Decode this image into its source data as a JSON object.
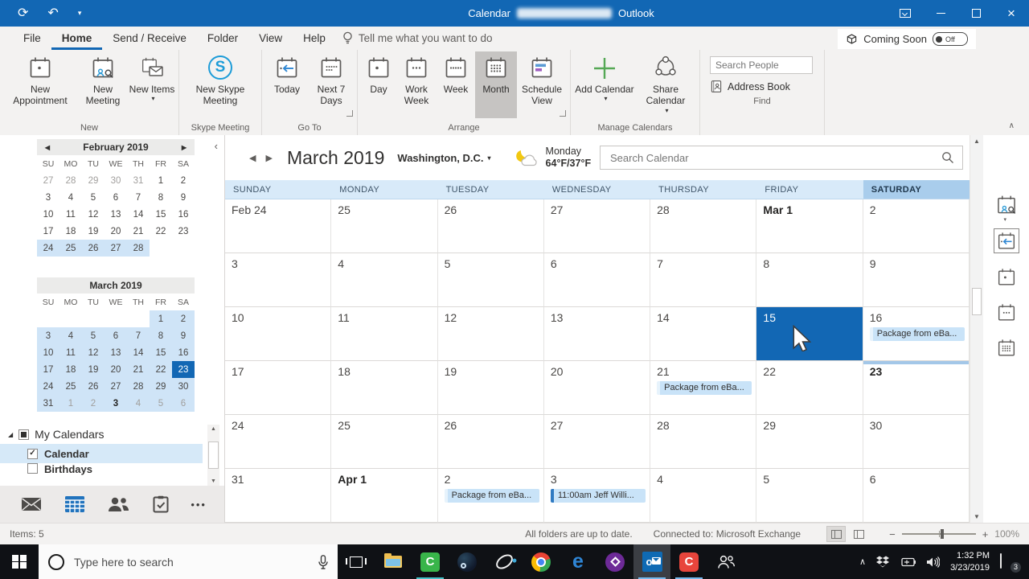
{
  "titlebar": {
    "app": "Calendar",
    "suffix": "Outlook"
  },
  "icons": {
    "sync": "⟳",
    "undo": "↶",
    "dropdown": "▾",
    "back": "◀",
    "forward": "▶",
    "collapse_left": "‹",
    "scroll_up": "▲",
    "scroll_down": "▼",
    "tray_up": "∧",
    "close": "×",
    "ellipsis": "•••",
    "expander": "◢",
    "check": "✓",
    "zoom_out": "−",
    "zoom_in": "+",
    "ribbon_collapse": "∧",
    "skype_s": "S",
    "camtasia_c": "C",
    "red_c": "C",
    "edge_e": "e"
  },
  "tabs": [
    {
      "label": "File"
    },
    {
      "label": "Home"
    },
    {
      "label": "Send / Receive"
    },
    {
      "label": "Folder"
    },
    {
      "label": "View"
    },
    {
      "label": "Help"
    }
  ],
  "tellme": "Tell me what you want to do",
  "coming_soon": {
    "label": "Coming Soon",
    "state": "Off"
  },
  "ribbon": {
    "new_appointment": "New Appointment",
    "new_meeting": "New Meeting",
    "new_items": "New Items",
    "new_skype_meeting": "New Skype Meeting",
    "today": "Today",
    "next_7_days": "Next 7 Days",
    "day": "Day",
    "work_week": "Work Week",
    "week": "Week",
    "month": "Month",
    "schedule_view": "Schedule View",
    "add_calendar": "Add Calendar",
    "share_calendar": "Share Calendar",
    "search_people_placeholder": "Search People",
    "address_book": "Address Book",
    "groups": {
      "new": "New",
      "skype": "Skype Meeting",
      "goto": "Go To",
      "arrange": "Arrange",
      "manage": "Manage Calendars",
      "find": "Find"
    }
  },
  "sidebar": {
    "day_headers": [
      "SU",
      "MO",
      "TU",
      "WE",
      "TH",
      "FR",
      "SA"
    ],
    "minical_feb": {
      "title": "February 2019",
      "weeks": [
        [
          {
            "t": "27",
            "mut": 1
          },
          {
            "t": "28",
            "mut": 1
          },
          {
            "t": "29",
            "mut": 1
          },
          {
            "t": "30",
            "mut": 1
          },
          {
            "t": "31",
            "mut": 1
          },
          {
            "t": "1"
          },
          {
            "t": "2"
          }
        ],
        [
          {
            "t": "3"
          },
          {
            "t": "4"
          },
          {
            "t": "5"
          },
          {
            "t": "6"
          },
          {
            "t": "7"
          },
          {
            "t": "8"
          },
          {
            "t": "9"
          }
        ],
        [
          {
            "t": "10"
          },
          {
            "t": "11"
          },
          {
            "t": "12"
          },
          {
            "t": "13"
          },
          {
            "t": "14"
          },
          {
            "t": "15"
          },
          {
            "t": "16"
          }
        ],
        [
          {
            "t": "17"
          },
          {
            "t": "18"
          },
          {
            "t": "19"
          },
          {
            "t": "20"
          },
          {
            "t": "21"
          },
          {
            "t": "22"
          },
          {
            "t": "23"
          }
        ],
        [
          {
            "t": "24",
            "hl": 1
          },
          {
            "t": "25",
            "hl": 1
          },
          {
            "t": "26",
            "hl": 1
          },
          {
            "t": "27",
            "hl": 1
          },
          {
            "t": "28",
            "hl": 1
          },
          {},
          {}
        ]
      ]
    },
    "minical_mar": {
      "title": "March 2019",
      "weeks": [
        [
          {},
          {},
          {},
          {},
          {},
          {
            "t": "1",
            "hl": 1
          },
          {
            "t": "2",
            "hl": 1
          }
        ],
        [
          {
            "t": "3",
            "hl": 1
          },
          {
            "t": "4",
            "hl": 1
          },
          {
            "t": "5",
            "hl": 1
          },
          {
            "t": "6",
            "hl": 1
          },
          {
            "t": "7",
            "hl": 1
          },
          {
            "t": "8",
            "hl": 1
          },
          {
            "t": "9",
            "hl": 1
          }
        ],
        [
          {
            "t": "10",
            "hl": 1
          },
          {
            "t": "11",
            "hl": 1
          },
          {
            "t": "12",
            "hl": 1
          },
          {
            "t": "13",
            "hl": 1
          },
          {
            "t": "14",
            "hl": 1
          },
          {
            "t": "15",
            "hl": 1
          },
          {
            "t": "16",
            "hl": 1
          }
        ],
        [
          {
            "t": "17",
            "hl": 1
          },
          {
            "t": "18",
            "hl": 1
          },
          {
            "t": "19",
            "hl": 1
          },
          {
            "t": "20",
            "hl": 1
          },
          {
            "t": "21",
            "hl": 1
          },
          {
            "t": "22",
            "hl": 1
          },
          {
            "t": "23",
            "sel": 1
          }
        ],
        [
          {
            "t": "24",
            "hl": 1
          },
          {
            "t": "25",
            "hl": 1
          },
          {
            "t": "26",
            "hl": 1
          },
          {
            "t": "27",
            "hl": 1
          },
          {
            "t": "28",
            "hl": 1
          },
          {
            "t": "29",
            "hl": 1
          },
          {
            "t": "30",
            "hl": 1
          }
        ],
        [
          {
            "t": "31",
            "hl": 1
          },
          {
            "t": "1",
            "hl": 1,
            "mut": 1
          },
          {
            "t": "2",
            "hl": 1,
            "mut": 1
          },
          {
            "t": "3",
            "hl": 1,
            "mut": 1,
            "b": 1
          },
          {
            "t": "4",
            "hl": 1,
            "mut": 1
          },
          {
            "t": "5",
            "hl": 1,
            "mut": 1
          },
          {
            "t": "6",
            "hl": 1,
            "mut": 1
          }
        ]
      ]
    },
    "my_calendars": {
      "header": "My Calendars",
      "items": [
        {
          "label": "Calendar",
          "checked": true
        },
        {
          "label": "Birthdays",
          "checked": false
        }
      ]
    }
  },
  "main": {
    "month_title": "March 2019",
    "location": "Washington,  D.C.",
    "weather": {
      "day": "Monday",
      "temps": "64°F/37°F"
    },
    "search_placeholder": "Search Calendar",
    "day_headers": [
      "SUNDAY",
      "MONDAY",
      "TUESDAY",
      "WEDNESDAY",
      "THURSDAY",
      "FRIDAY",
      "SATURDAY"
    ],
    "cells": [
      {
        "t": "Feb 24"
      },
      {
        "t": "25"
      },
      {
        "t": "26"
      },
      {
        "t": "27"
      },
      {
        "t": "28"
      },
      {
        "t": "Mar 1",
        "b": 1
      },
      {
        "t": "2"
      },
      {
        "t": "3"
      },
      {
        "t": "4"
      },
      {
        "t": "5"
      },
      {
        "t": "6"
      },
      {
        "t": "7"
      },
      {
        "t": "8"
      },
      {
        "t": "9"
      },
      {
        "t": "10"
      },
      {
        "t": "11"
      },
      {
        "t": "12"
      },
      {
        "t": "13"
      },
      {
        "t": "14"
      },
      {
        "t": "15",
        "sel": 1
      },
      {
        "t": "16",
        "ev": [
          {
            "t": "Package from eBa...",
            "timed": 0
          }
        ]
      },
      {
        "t": "17"
      },
      {
        "t": "18"
      },
      {
        "t": "19"
      },
      {
        "t": "20"
      },
      {
        "t": "21",
        "ev": [
          {
            "t": "Package from eBa...",
            "timed": 0
          }
        ]
      },
      {
        "t": "22"
      },
      {
        "t": "23",
        "b": 1,
        "today": 1
      },
      {
        "t": "24"
      },
      {
        "t": "25"
      },
      {
        "t": "26"
      },
      {
        "t": "27"
      },
      {
        "t": "28"
      },
      {
        "t": "29"
      },
      {
        "t": "30"
      },
      {
        "t": "31"
      },
      {
        "t": "Apr 1",
        "b": 1
      },
      {
        "t": "2",
        "ev": [
          {
            "t": "Package from eBa...",
            "timed": 0
          }
        ]
      },
      {
        "t": "3",
        "ev": [
          {
            "t": "11:00am Jeff Willi...",
            "timed": 1
          }
        ]
      },
      {
        "t": "4"
      },
      {
        "t": "5"
      },
      {
        "t": "6"
      }
    ]
  },
  "statusbar": {
    "items": "Items: 5",
    "folders": "All folders are up to date.",
    "connected": "Connected to: Microsoft Exchange",
    "zoom": "100%"
  },
  "taskbar": {
    "search_placeholder": "Type here to search",
    "time": "1:32 PM",
    "date": "3/23/2019",
    "badge": "3"
  }
}
